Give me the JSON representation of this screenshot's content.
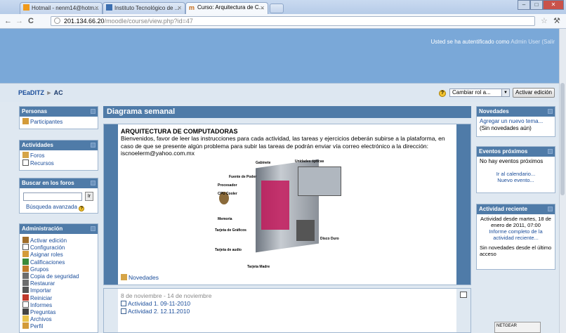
{
  "browser": {
    "tabs": [
      {
        "label": "Hotmail - nenm14@hotm..."
      },
      {
        "label": "Instituto Tecnológico de ..."
      },
      {
        "label": "Curso: Arquitectura de C..."
      }
    ],
    "url_host": "201.134.66.20",
    "url_path": "/moodle/course/view.php?id=47"
  },
  "header": {
    "login_prefix": "Usted se ha autentificado como",
    "user": "Admin User",
    "logout": "(Salir"
  },
  "navbar": {
    "breadcrumb_root": "PEaDITZ",
    "breadcrumb_sep": "►",
    "breadcrumb_course": "AC",
    "role_select": "Cambiar rol a...",
    "edit_button": "Activar edición"
  },
  "left": {
    "personas": {
      "title": "Personas",
      "items": [
        "Participantes"
      ]
    },
    "actividades": {
      "title": "Actividades",
      "items": [
        "Foros",
        "Recursos"
      ]
    },
    "search": {
      "title": "Buscar en los foros",
      "go": "Ir",
      "advanced": "Búsqueda avanzada"
    },
    "admin": {
      "title": "Administración",
      "items": [
        "Activar edición",
        "Configuración",
        "Asignar roles",
        "Calificaciones",
        "Grupos",
        "Copia de seguridad",
        "Restaurar",
        "Importar",
        "Reiniciar",
        "Informes",
        "Preguntas",
        "Archivos",
        "Perfil"
      ]
    }
  },
  "main": {
    "title": "Diagrama semanal",
    "heading": "ARQUITECTURA DE COMPUTADORAS",
    "intro": "Bienvenidos, favor de leer las instrucciones para cada actividad, las tareas y ejercicios deberán subirse a la plataforma, en caso de que se presente algún problema para subir las tareas de podrán enviar vía correo electrónico a la dirección: iscnoelerm@yahoo.com.mx",
    "image_labels": [
      "Gabinete",
      "Unidades ópticas",
      "Fuente de Poder",
      "Procesador",
      "CPU Cooler",
      "Memoria",
      "Tarjeta de Gráficos",
      "Disco Duro",
      "Tarjeta de audio",
      "Tarjeta Madre"
    ],
    "news_link": "Novedades",
    "week": {
      "dates": "8 de noviembre - 14 de noviembre",
      "activities": [
        "Actividad 1. 09-11-2010",
        "Actividad 2. 12.11.2010"
      ]
    }
  },
  "right": {
    "news": {
      "title": "Novedades",
      "add": "Agregar un nuevo tema...",
      "none": "(Sin novedades aún)"
    },
    "events": {
      "title": "Eventos próximos",
      "none": "No hay eventos próximos",
      "calendar": "Ir al calendario...",
      "new": "Nuevo evento..."
    },
    "recent": {
      "title": "Actividad reciente",
      "since": "Actividad desde martes, 18 de enero de 2011, 07:00",
      "report": "Informe completo de la actividad reciente...",
      "none": "Sin novedades desde el último acceso"
    }
  },
  "tray": {
    "label": "NETGEAR"
  },
  "colors": {
    "header": "#7aa8d8",
    "block_header": "#4f7ba8",
    "link": "#1a4d9a"
  }
}
